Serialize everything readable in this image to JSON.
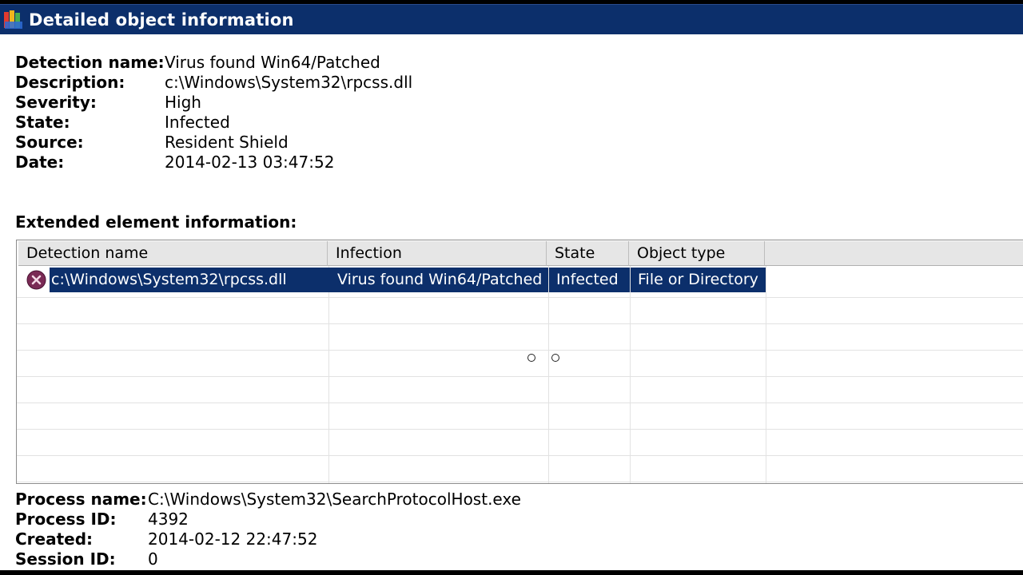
{
  "window": {
    "title": "Detailed object information"
  },
  "details": [
    {
      "key": "Detection name:",
      "value": "Virus found Win64/Patched"
    },
    {
      "key": "Description:",
      "value": "c:\\Windows\\System32\\rpcss.dll"
    },
    {
      "key": "Severity:",
      "value": "High"
    },
    {
      "key": "State:",
      "value": "Infected"
    },
    {
      "key": "Source:",
      "value": "Resident Shield"
    },
    {
      "key": "Date:",
      "value": "2014-02-13 03:47:52"
    }
  ],
  "extended": {
    "label": "Extended element information:",
    "columns": [
      "Detection name",
      "Infection",
      "State",
      "Object type"
    ],
    "rows": [
      {
        "detection_name": "c:\\Windows\\System32\\rpcss.dll",
        "infection": "Virus found Win64/Patched",
        "state": "Infected",
        "object_type": "File or Directory",
        "icon": "infected-x-icon"
      }
    ]
  },
  "process": [
    {
      "key": "Process name:",
      "value": "C:\\Windows\\System32\\SearchProtocolHost.exe"
    },
    {
      "key": "Process ID:",
      "value": "4392"
    },
    {
      "key": "Created:",
      "value": "2014-02-12 22:47:52"
    },
    {
      "key": "Session ID:",
      "value": "0"
    }
  ],
  "colors": {
    "titlebar": "#0c2f6b",
    "selection": "#0c2f6b",
    "header": "#e6e6e6"
  }
}
